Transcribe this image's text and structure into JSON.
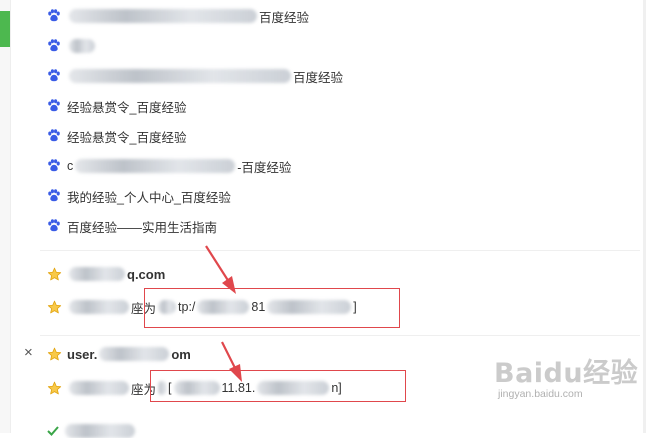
{
  "colors": {
    "paw": "#3a5ce6",
    "star": "#f2b81c",
    "annotation": "#e0474c",
    "brand_green": "#4db84f"
  },
  "history_items": [
    {
      "suffix": "百度经验"
    },
    {
      "suffix": ""
    },
    {
      "suffix": "百度经验"
    },
    {
      "text": "经验悬赏令_百度经验"
    },
    {
      "text": "经验悬赏令_百度经验"
    },
    {
      "prefix": "c",
      "suffix": "-百度经验"
    },
    {
      "text": "我的经验_个人中心_百度经验"
    },
    {
      "text": "百度经验——实用生活指南"
    }
  ],
  "groups": [
    {
      "domain_suffix": "q.com",
      "entry_mid": "座为",
      "entry_url_a": "tp:/",
      "entry_url_b": "81",
      "entry_end": "]"
    },
    {
      "domain_prefix": "user.",
      "domain_suffix": "om",
      "entry_mid": "座为",
      "entry_url_a": "[",
      "entry_url_b": "11.81.",
      "entry_end": "n]"
    }
  ],
  "close_label": "×",
  "watermark": {
    "main": "Baidu经验",
    "sub": "jingyan.baidu.com"
  }
}
